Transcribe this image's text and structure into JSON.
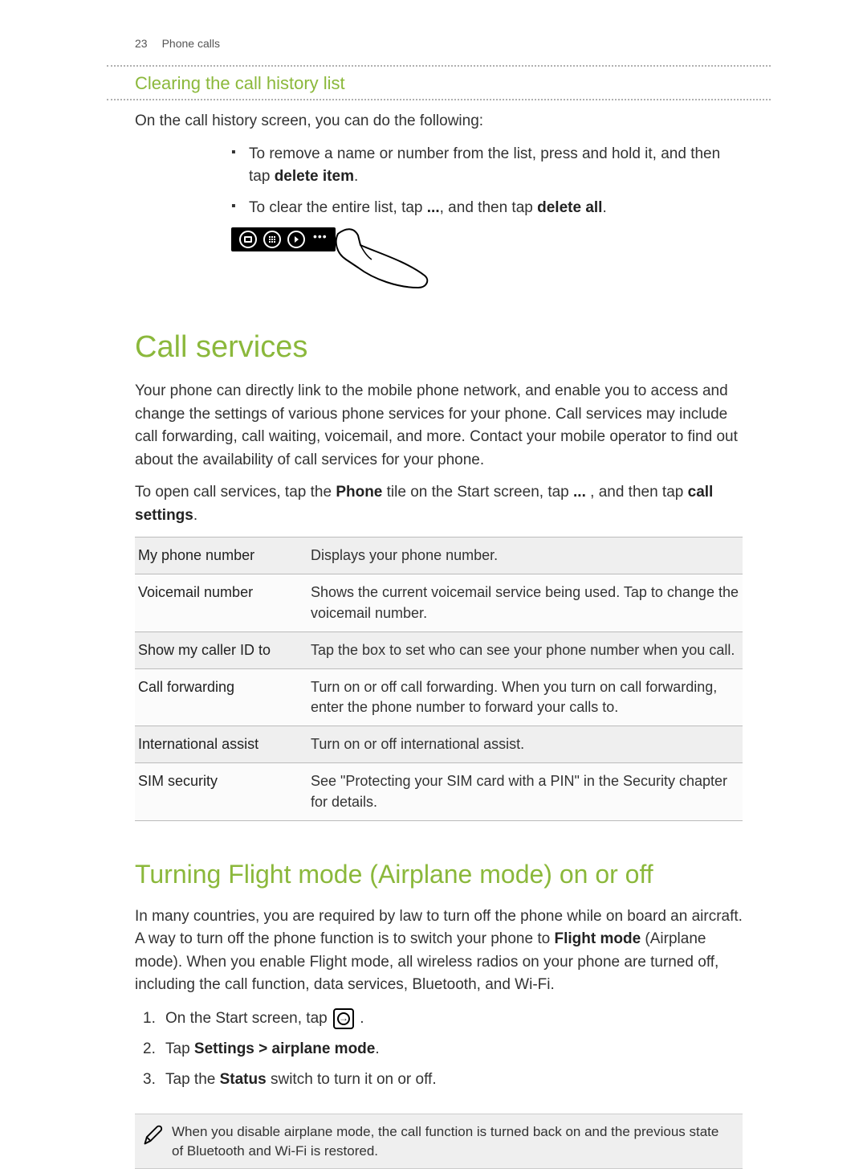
{
  "header": {
    "pageNumber": "23",
    "sectionTitle": "Phone calls"
  },
  "clearHistory": {
    "heading": "Clearing the call history list",
    "intro": "On the call history screen, you can do the following:",
    "bullets": {
      "b1_pre": "To remove a name or number from the list, press and hold it, and then tap ",
      "b1_bold": "delete item",
      "b1_post": ".",
      "b2_pre": "To clear the entire list, tap ",
      "b2_mid": ", and then tap ",
      "b2_bold": "delete all",
      "b2_post": ".",
      "ellipsis": "..."
    }
  },
  "callServices": {
    "heading": "Call services",
    "para": "Your phone can directly link to the mobile phone network, and enable you to access and change the settings of various phone services for your phone. Call services may include call forwarding, call waiting, voicemail, and more. Contact your mobile operator to find out about the availability of call services for your phone.",
    "open_pre": "To open call services, tap the ",
    "open_phone": "Phone",
    "open_mid": " tile on the Start screen, tap ",
    "open_ellipsis": "...",
    "open_mid2": " , and then tap ",
    "open_bold2": "call settings",
    "open_post": ".",
    "rows": [
      {
        "label": "My phone number",
        "desc": "Displays your phone number."
      },
      {
        "label": "Voicemail number",
        "desc": "Shows the current voicemail service being used. Tap to change the voicemail number."
      },
      {
        "label": "Show my caller ID to",
        "desc": "Tap the box to set who can see your phone number when you call."
      },
      {
        "label": "Call forwarding",
        "desc": "Turn on or off call forwarding. When you turn on call forwarding, enter the phone number to forward your calls to."
      },
      {
        "label": "International assist",
        "desc": "Turn on or off international assist."
      },
      {
        "label": "SIM security",
        "desc": "See \"Protecting your SIM card with a PIN\" in the Security chapter for details."
      }
    ]
  },
  "flightMode": {
    "heading": "Turning Flight mode (Airplane mode) on or off",
    "para_pre": "In many countries, you are required by law to turn off the phone while on board an aircraft. A way to turn off the phone function is to switch your phone to ",
    "para_bold": "Flight mode",
    "para_post": " (Airplane mode). When you enable Flight mode, all wireless radios on your phone are turned off, including the call function, data services, Bluetooth, and Wi-Fi.",
    "steps": {
      "s1_pre": "On the Start screen, tap ",
      "s1_post": " .",
      "s2_pre": "Tap ",
      "s2_bold": "Settings > airplane mode",
      "s2_post": ".",
      "s3_pre": "Tap the ",
      "s3_bold": "Status",
      "s3_post": " switch to turn it on or off."
    },
    "note": "When you disable airplane mode, the call function is turned back on and the previous state of Bluetooth and Wi-Fi is restored."
  }
}
